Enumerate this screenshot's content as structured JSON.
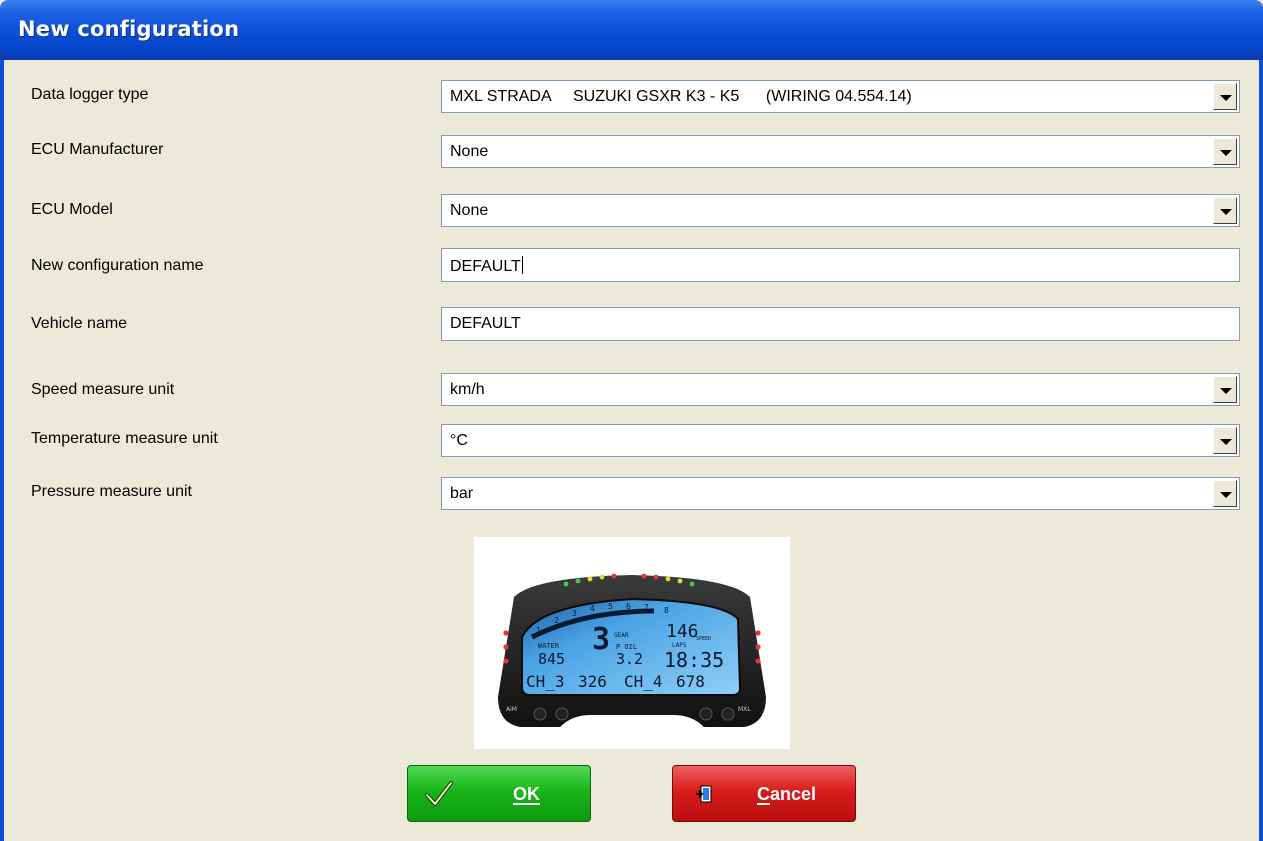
{
  "window": {
    "title": "New configuration"
  },
  "form": {
    "data_logger_type": {
      "label": "Data logger type",
      "value": "MXL STRADA     SUZUKI GSXR K3 - K5      (WIRING 04.554.14)"
    },
    "ecu_manufacturer": {
      "label": "ECU Manufacturer",
      "value": "None"
    },
    "ecu_model": {
      "label": "ECU Model",
      "value": "None"
    },
    "new_configuration_name": {
      "label": "New configuration name",
      "value": "DEFAULT"
    },
    "vehicle_name": {
      "label": "Vehicle name",
      "value": "DEFAULT"
    },
    "speed_unit": {
      "label": "Speed measure unit",
      "value": "km/h"
    },
    "temperature_unit": {
      "label": "Temperature measure unit",
      "value": "°C"
    },
    "pressure_unit": {
      "label": "Pressure measure unit",
      "value": "bar"
    }
  },
  "dashboard": {
    "gear": "3",
    "gear_label": "GEAR",
    "speed": "146",
    "speed_label": "SPEED",
    "water_label": "WATER",
    "water_value": "845",
    "oil_label": "P OIL",
    "oil_value": "3.2",
    "lap_label": "LAPS",
    "lap_time": "18:35",
    "ch3_label": "CH_3",
    "ch3_value": "326",
    "ch4_label": "CH_4",
    "ch4_value": "678",
    "brand": "AiM",
    "model": "MXL",
    "rpm_scale": [
      "1",
      "2",
      "3",
      "4",
      "5",
      "6",
      "7",
      "8"
    ]
  },
  "buttons": {
    "ok": "OK",
    "cancel_first": "C",
    "cancel_rest": "ancel"
  },
  "colors": {
    "title_bar": "#0a4fd7",
    "ok_button": "#19b519",
    "cancel_button": "#d81c1c",
    "dialog_bg": "#ece9d8"
  }
}
